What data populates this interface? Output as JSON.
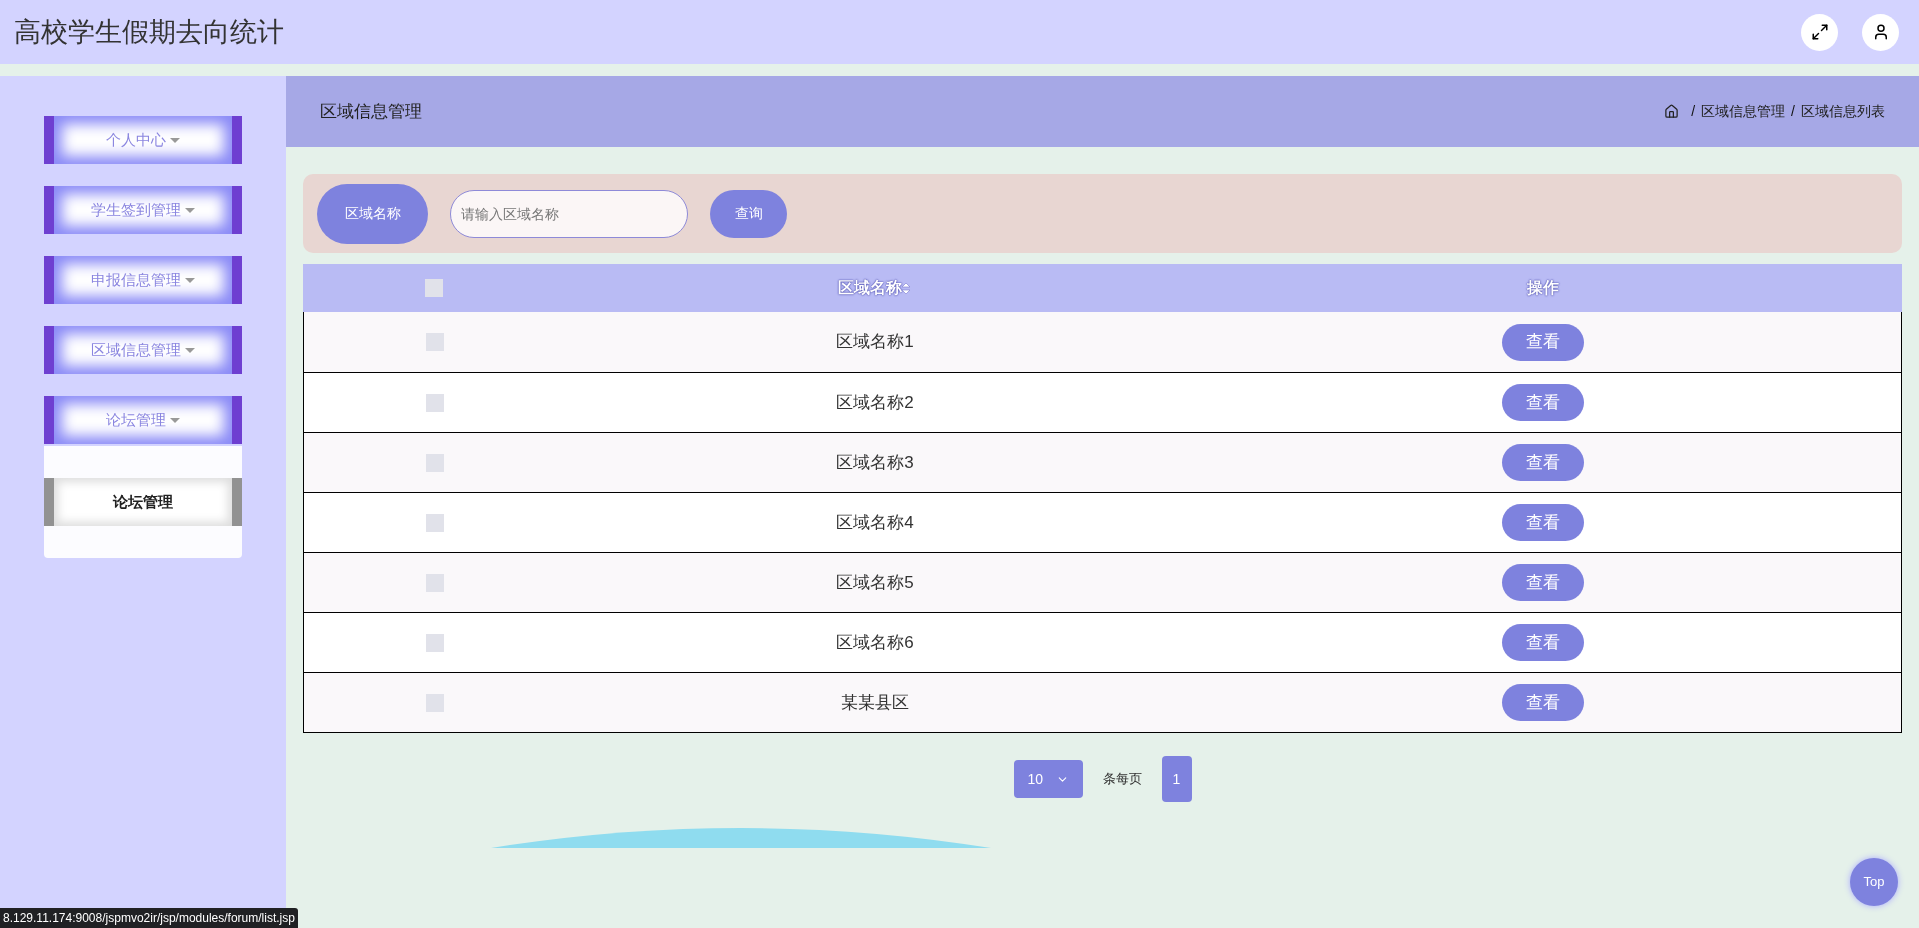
{
  "header": {
    "title": "高校学生假期去向统计"
  },
  "sidebar": {
    "items": [
      {
        "label": "个人中心"
      },
      {
        "label": "学生签到管理"
      },
      {
        "label": "申报信息管理"
      },
      {
        "label": "区域信息管理"
      },
      {
        "label": "论坛管理",
        "children": [
          {
            "label": "论坛管理",
            "hovered": true
          }
        ]
      }
    ]
  },
  "page_header": {
    "title": "区域信息管理",
    "breadcrumb_separator": "/",
    "breadcrumb": [
      "区域信息管理",
      "区域信息列表"
    ]
  },
  "search": {
    "label": "区域名称",
    "placeholder": "请输入区域名称",
    "button": "查询"
  },
  "table": {
    "select_all_checked": false,
    "columns": [
      "区域名称",
      "操作"
    ],
    "rows": [
      {
        "name": "区域名称1",
        "action": "查看",
        "checked": false
      },
      {
        "name": "区域名称2",
        "action": "查看",
        "checked": false
      },
      {
        "name": "区域名称3",
        "action": "查看",
        "checked": false
      },
      {
        "name": "区域名称4",
        "action": "查看",
        "checked": false
      },
      {
        "name": "区域名称5",
        "action": "查看",
        "checked": false
      },
      {
        "name": "区域名称6",
        "action": "查看",
        "checked": false
      },
      {
        "name": "某某县区",
        "action": "查看",
        "checked": false
      }
    ]
  },
  "pagination": {
    "page_size": "10",
    "per_page_label": "条每页",
    "pages": [
      {
        "label": "1",
        "selected": true
      }
    ]
  },
  "top_button": "Top",
  "status_url": "8.129.11.174:9008/jspmvo2ir/jsp/modules/forum/list.jsp"
}
